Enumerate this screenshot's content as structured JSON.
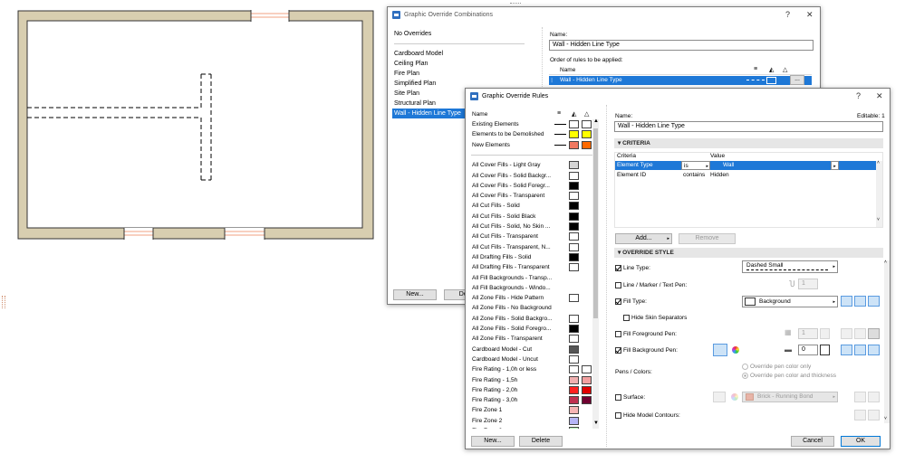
{
  "combinations_dialog": {
    "title": "Graphic Override Combinations",
    "help": "?",
    "close": "✕",
    "items": [
      "No Overrides",
      "Cardboard Model",
      "Ceiling Plan",
      "Fire Plan",
      "Simplified Plan",
      "Site Plan",
      "Structural Plan",
      "Wall - Hidden Line Type"
    ],
    "selected_index": 7,
    "name_label": "Name:",
    "name_value": "Wall - Hidden Line Type",
    "order_label": "Order of rules to be applied:",
    "col_name": "Name",
    "rule_row": "Wall - Hidden Line Type",
    "rule_row_btn": "...",
    "new_btn": "New...",
    "delete_btn": "Dele"
  },
  "rules_dialog": {
    "title": "Graphic Override Rules",
    "help": "?",
    "close": "✕",
    "list_header": "Name",
    "rules": [
      {
        "name": "Existing Elements",
        "sw": [
          "#ffffff",
          "#ffffff"
        ]
      },
      {
        "name": "Elements to be Demolished",
        "sw": [
          "#ffff00",
          "#ffff00"
        ]
      },
      {
        "name": "New Elements",
        "sw": [
          "#f07860",
          "#ff6a00"
        ]
      },
      {
        "name": "",
        "sw": []
      },
      {
        "name": "All Cover Fills - Light Gray",
        "sw": [
          "#d4d4d4"
        ]
      },
      {
        "name": "All Cover Fills - Solid Backgr...",
        "sw": [
          "#ffffff"
        ]
      },
      {
        "name": "All Cover Fills - Solid Foregr...",
        "sw": [
          "#000000"
        ]
      },
      {
        "name": "All Cover Fills - Transparent",
        "sw": [
          "#ffffff"
        ]
      },
      {
        "name": "All Cut Fills - Solid",
        "sw": [
          "#000000"
        ]
      },
      {
        "name": "All Cut Fills - Solid Black",
        "sw": [
          "#000000"
        ]
      },
      {
        "name": "All Cut Fills - Solid, No Skin ...",
        "sw": [
          "#000000"
        ]
      },
      {
        "name": "All Cut Fills - Transparent",
        "sw": [
          "#ffffff"
        ]
      },
      {
        "name": "All Cut Fills - Transparent, N...",
        "sw": [
          "#ffffff"
        ]
      },
      {
        "name": "All Drafting Fills - Solid",
        "sw": [
          "#000000"
        ]
      },
      {
        "name": "All Drafting Fills - Transparent",
        "sw": [
          "#ffffff"
        ]
      },
      {
        "name": "All Fill Backgrounds - Transp...",
        "sw": []
      },
      {
        "name": "All Fill Backgrounds - Windo...",
        "sw": []
      },
      {
        "name": "All Zone Fills - Hide Pattern",
        "sw": [
          "#ffffff"
        ]
      },
      {
        "name": "All Zone Fills - No Background",
        "sw": []
      },
      {
        "name": "All Zone Fills - Solid Backgro...",
        "sw": [
          "#ffffff"
        ]
      },
      {
        "name": "All Zone Fills - Solid Foregro...",
        "sw": [
          "#000000"
        ]
      },
      {
        "name": "All Zone Fills - Transparent",
        "sw": [
          "#ffffff"
        ]
      },
      {
        "name": "Cardboard Model - Cut",
        "sw": [
          "#555555"
        ]
      },
      {
        "name": "Cardboard Model - Uncut",
        "sw": [
          "#ffffff"
        ]
      },
      {
        "name": "Fire Rating - 1,0h or less",
        "sw": [
          "#ffffff",
          "#ffffff"
        ]
      },
      {
        "name": "Fire Rating - 1,5h",
        "sw": [
          "#f0b0b0",
          "#f3a0a0"
        ]
      },
      {
        "name": "Fire Rating - 2,0h",
        "sw": [
          "#ff2020",
          "#e00000"
        ]
      },
      {
        "name": "Fire Rating - 3,0h",
        "sw": [
          "#c03050",
          "#700030"
        ]
      },
      {
        "name": "Fire Zone 1",
        "sw": [
          "#f5b5b5"
        ]
      },
      {
        "name": "Fire Zone 2",
        "sw": [
          "#b5b5f5"
        ]
      },
      {
        "name": "Fire Zone 3",
        "sw": [
          "#b5f5b5"
        ]
      }
    ],
    "new_btn": "New...",
    "delete_btn": "Delete",
    "name_label": "Name:",
    "editable_label": "Editable: 1",
    "name_value": "Wall - Hidden Line Type",
    "criteria_section": "CRITERIA",
    "criteria_cols": {
      "criteria": "Criteria",
      "value": "Value"
    },
    "criteria_rows": [
      {
        "criteria": "Element Type",
        "op": "is",
        "value": "Wall"
      },
      {
        "criteria": "Element ID",
        "op": "contains",
        "value": "Hidden"
      }
    ],
    "add_btn": "Add...",
    "remove_btn": "Remove",
    "override_section": "OVERRIDE STYLE",
    "line_type_label": "Line Type:",
    "line_type_value": "Dashed Small",
    "marker_label": "Line / Marker / Text Pen:",
    "pen_value": "1",
    "fill_type_label": "Fill Type:",
    "fill_type_value": "Background",
    "hide_skin_label": "Hide Skin Separators",
    "fill_fg_label": "Fill Foreground Pen:",
    "fill_fg_value": "1",
    "fill_bg_label": "Fill Background Pen:",
    "fill_bg_value": "0",
    "pens_colors_label": "Pens / Colors:",
    "radio_color_only": "Override pen color only",
    "radio_color_thick": "Override pen color and thickness",
    "surface_label": "Surface:",
    "surface_value": "Brick - Running Bond",
    "hide_contours_label": "Hide Model Contours:",
    "cancel_btn": "Cancel",
    "ok_btn": "OK"
  }
}
